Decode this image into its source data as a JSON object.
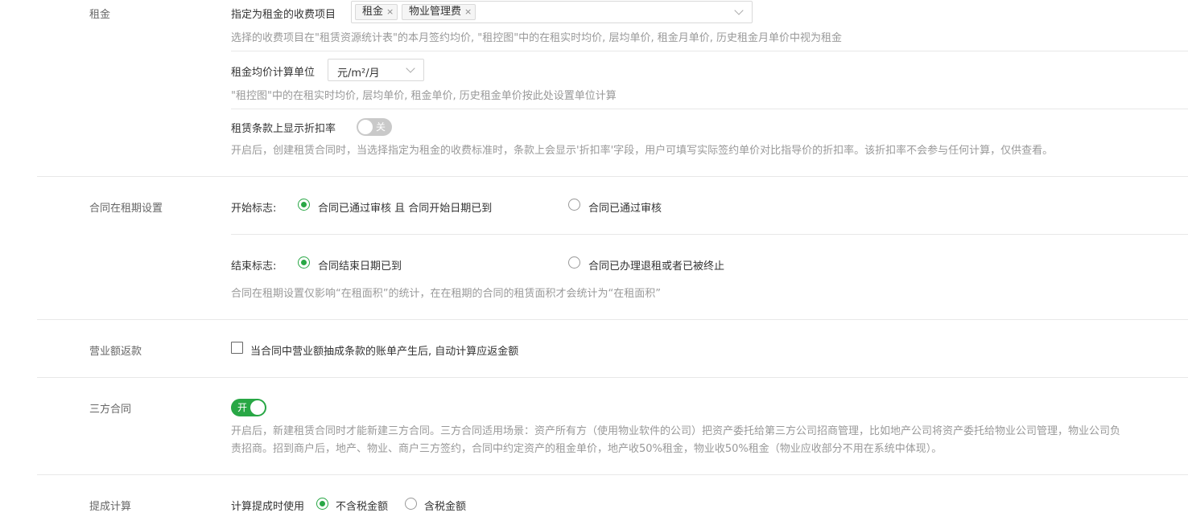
{
  "rent": {
    "section_label": "租金",
    "fee_items_label": "指定为租金的收费项目",
    "fee_tags": [
      {
        "label": "租金",
        "close": "×"
      },
      {
        "label": "物业管理费",
        "close": "×"
      }
    ],
    "fee_help": "选择的收费项目在\"租赁资源统计表\"的本月签约均价, \"租控图\"中的在租实时均价, 层均单价, 租金月单价, 历史租金月单价中视为租金",
    "unit_label": "租金均价计算单位",
    "unit_value": "元/m²/月",
    "unit_help": "\"租控图\"中的在租实时均价, 层均单价, 租金单价, 历史租金单价按此处设置单位计算",
    "discount_label": "租赁条款上显示折扣率",
    "discount_switch": "关",
    "discount_help": "开启后，创建租赁合同时，当选择指定为租金的收费标准时，条款上会显示'折扣率'字段，用户可填写实际签约单价对比指导价的折扣率。该折扣率不会参与任何计算，仅供查看。"
  },
  "lease_term": {
    "section_label": "合同在租期设置",
    "start_label": "开始标志:",
    "start_options": [
      "合同已通过审核 且 合同开始日期已到",
      "合同已通过审核"
    ],
    "start_selected": 0,
    "end_label": "结束标志:",
    "end_options": [
      "合同结束日期已到",
      "合同已办理退租或者已被终止"
    ],
    "end_selected": 0,
    "help": "合同在租期设置仅影响“在租面积”的统计，在在租期的合同的租赁面积才会统计为“在租面积”"
  },
  "revenue_refund": {
    "section_label": "营业额返款",
    "checkbox_label": "当合同中营业额抽成条款的账单产生后, 自动计算应返金额",
    "checked": false
  },
  "tripartite": {
    "section_label": "三方合同",
    "switch_label": "开",
    "enabled": true,
    "help_line1": "开启后，新建租赁合同时才能新建三方合同。三方合同适用场景：资产所有方（使用物业软件的公司）把资产委托给第三方公司招商管理，比如地产公司将资产委托给物业公司管理，物业公司负",
    "help_line2": "责招商。招到商户后，地产、物业、商户三方签约，合同中约定资产的租金单价，地产收50%租金，物业收50%租金（物业应收部分不用在系统中体现）。"
  },
  "commission": {
    "section_label": "提成计算",
    "label": "计算提成时使用",
    "options": [
      "不含税金额",
      "含税金额"
    ],
    "selected": 0
  },
  "colors": {
    "accent": "#28a745",
    "switch_off": "#c9c9c9",
    "help_text": "#999999",
    "divider": "#e8e8e8"
  },
  "icons": [
    "close-icon",
    "chevron-down-icon"
  ]
}
